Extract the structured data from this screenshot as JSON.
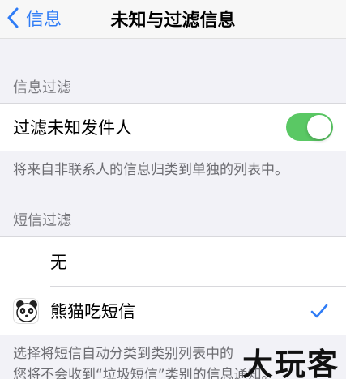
{
  "nav": {
    "back_label": "信息",
    "title": "未知与过滤信息"
  },
  "section_filter": {
    "header": "信息过滤",
    "filter_unknown_label": "过滤未知发件人",
    "filter_unknown_enabled": true,
    "footer": "将来自非联系人的信息归类到单独的列表中。"
  },
  "section_sms": {
    "header": "短信过滤",
    "options": [
      {
        "label": "无",
        "selected": false
      },
      {
        "label": "熊猫吃短信",
        "selected": true
      }
    ],
    "footer_line1": "选择将短信自动分类到类别列表中的",
    "footer_line2": "您将不会收到“垃圾短信”类别的信息通知。"
  },
  "watermark": "大玩客",
  "colors": {
    "accent": "#2f7cf6",
    "toggle_on": "#5ac864",
    "background": "#f2f2f7"
  }
}
